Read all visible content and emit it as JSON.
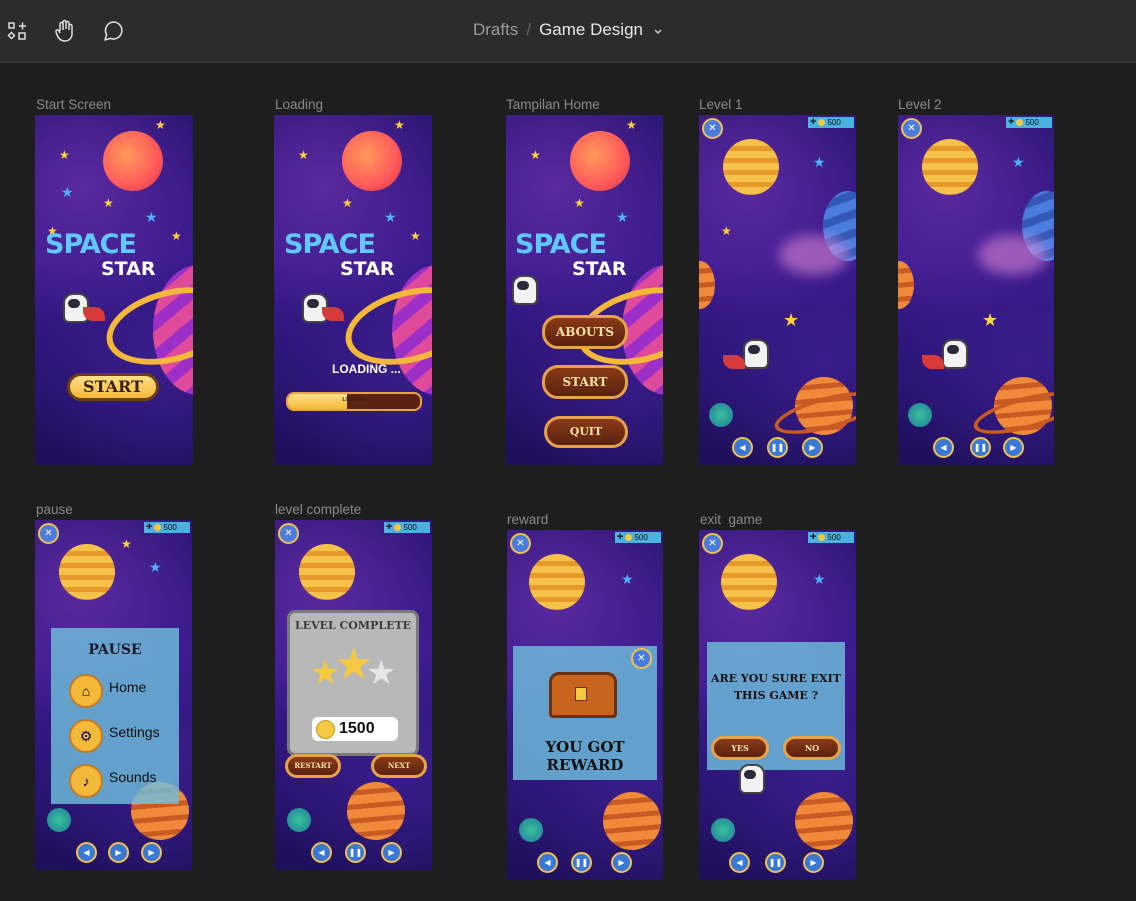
{
  "toolbar": {
    "icons": [
      "apps-icon",
      "hand-icon",
      "comment-icon"
    ],
    "breadcrumb": {
      "parent": "Drafts",
      "separator": "/",
      "current": "Game Design"
    }
  },
  "frames": {
    "start": {
      "label": "Start Screen",
      "title1": "SPACE",
      "title2": "STAR",
      "button": "START"
    },
    "loading": {
      "label": "Loading",
      "title1": "SPACE",
      "title2": "STAR",
      "text": "LOADING ...",
      "bar_text": "LOADING",
      "progress": 0.45
    },
    "home": {
      "label": "Tampilan Home",
      "title1": "SPACE",
      "title2": "STAR",
      "btn_abouts": "ABOUTS",
      "btn_start": "START",
      "btn_quit": "QUIT"
    },
    "level1": {
      "label": "Level 1",
      "coins": "500"
    },
    "level2": {
      "label": "Level 2",
      "coins": "500"
    },
    "pause": {
      "label": "pause",
      "coins": "500",
      "title": "PAUSE",
      "items": [
        "Home",
        "Settings",
        "Sounds"
      ]
    },
    "complete": {
      "label": "level complete",
      "coins": "500",
      "title": "LEVEL COMPLETE",
      "score": "1500",
      "btn_restart": "RESTART",
      "btn_next": "NEXT"
    },
    "reward": {
      "label": "reward",
      "coins": "500",
      "text": "YOU GOT REWARD"
    },
    "exit": {
      "label": "exit  game",
      "coins": "500",
      "question": "ARE YOU SURE EXIT THIS GAME ?",
      "btn_yes": "YES",
      "btn_no": "NO"
    }
  },
  "colors": {
    "topbar": "#2c2c2c",
    "canvas": "#1e1e1e",
    "accent_blue": "#5ec8ff",
    "gold": "#f5b93a"
  }
}
